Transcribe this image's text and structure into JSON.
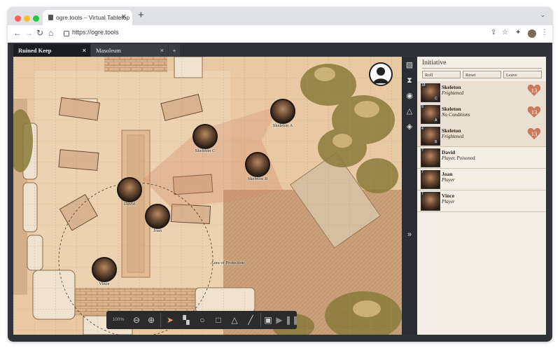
{
  "browser": {
    "tab_title": "ogre.tools – Virtual Tabletop",
    "url": "https://ogre.tools",
    "colors": {
      "close": "#ff5f57",
      "min": "#febc2e",
      "max": "#28c840"
    }
  },
  "app": {
    "tabs": [
      {
        "label": "Ruined Keep",
        "active": true
      },
      {
        "label": "Masoleum",
        "active": false
      }
    ],
    "add_tab": "+",
    "close_glyph": "×"
  },
  "map": {
    "tokens": [
      {
        "name": "Skeleton A",
        "icon": "skeleton-portrait"
      },
      {
        "name": "Skeleton C",
        "icon": "skeleton-portrait"
      },
      {
        "name": "Skeleton B",
        "icon": "skeleton-portrait"
      },
      {
        "name": "David",
        "icon": "hero-portrait"
      },
      {
        "name": "Joan",
        "icon": "hero-portrait"
      },
      {
        "name": "Vince",
        "icon": "hero-portrait"
      }
    ],
    "aura_label": "Aura of Protection",
    "toolbar": {
      "zoom": "100%",
      "tools": [
        "zoom-out-icon",
        "zoom-in-icon",
        "pointer-icon",
        "wall-icon",
        "circle-icon",
        "square-icon",
        "triangle-icon",
        "line-icon",
        "scene-icon",
        "play-icon",
        "pause-icon"
      ]
    }
  },
  "rail": {
    "icons": [
      "image-icon",
      "hourglass-icon",
      "user-icon",
      "triangle-icon",
      "dice-icon",
      "expand-icon"
    ]
  },
  "initiative": {
    "title": "Initiative",
    "buttons": [
      "Roll",
      "Reset",
      "Leave"
    ],
    "rows": [
      {
        "roll": "18",
        "sub": "C",
        "name": "Skeleton",
        "condition": "Frightened",
        "hp": "13",
        "enemy": true
      },
      {
        "roll": "9",
        "sub": "A",
        "name": "Skeleton",
        "condition": "No Conditions",
        "hp": "13",
        "enemy": true
      },
      {
        "roll": "4",
        "sub": "B",
        "name": "Skeleton",
        "condition": "Frightened",
        "hp": "13",
        "enemy": true
      },
      {
        "roll": "7",
        "sub": "",
        "name": "David",
        "condition": "Player, Poisoned",
        "hp": "",
        "enemy": false
      },
      {
        "roll": "7",
        "sub": "",
        "name": "Joan",
        "condition": "Player",
        "hp": "",
        "enemy": false
      },
      {
        "roll": "7",
        "sub": "",
        "name": "Vince",
        "condition": "Player",
        "hp": "",
        "enemy": false
      }
    ],
    "hp_color": "#c97a5a"
  }
}
